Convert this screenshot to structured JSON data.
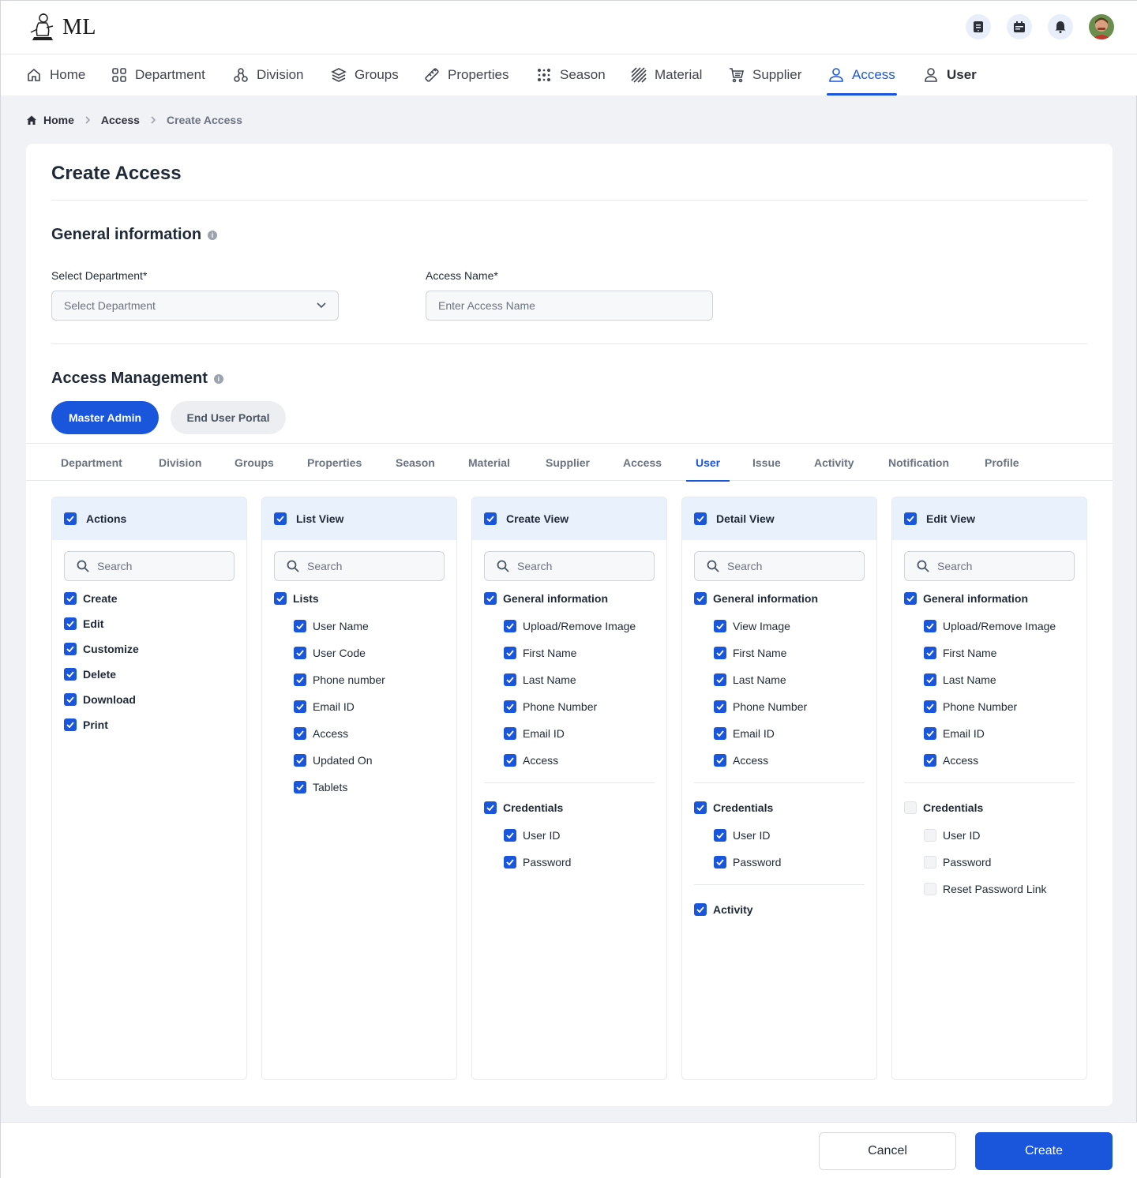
{
  "brand": {
    "logo_text": "ML"
  },
  "nav": [
    {
      "label": "Home",
      "icon": "home-icon"
    },
    {
      "label": "Department",
      "icon": "grid-icon"
    },
    {
      "label": "Division",
      "icon": "hierarchy-icon"
    },
    {
      "label": "Groups",
      "icon": "layers-icon"
    },
    {
      "label": "Properties",
      "icon": "ruler-icon"
    },
    {
      "label": "Season",
      "icon": "dots-grid-icon"
    },
    {
      "label": "Material",
      "icon": "stripes-icon"
    },
    {
      "label": "Supplier",
      "icon": "cart-icon"
    },
    {
      "label": "Access",
      "icon": "user-lock-icon"
    },
    {
      "label": "User",
      "icon": "user-icon"
    }
  ],
  "nav_active": "Access",
  "breadcrumb": {
    "home": "Home",
    "parent": "Access",
    "current": "Create Access"
  },
  "page": {
    "title": "Create Access"
  },
  "general": {
    "heading": "General information",
    "department_label": "Select Department*",
    "department_placeholder": "Select Department",
    "access_name_label": "Access Name*",
    "access_name_placeholder": "Enter Access Name"
  },
  "access_mgmt": {
    "heading": "Access Management",
    "portal_tabs": [
      "Master Admin",
      "End User Portal"
    ],
    "portal_active": "Master Admin",
    "module_tabs": [
      "Department",
      "Division",
      "Groups",
      "Properties",
      "Season",
      "Material",
      "Supplier",
      "Access",
      "User",
      "Issue",
      "Activity",
      "Notification",
      "Profile"
    ],
    "module_active": "User"
  },
  "search_placeholder": "Search",
  "panels": [
    {
      "title": "Actions",
      "checked": true,
      "groups": [
        {
          "items": [
            {
              "label": "Create",
              "checked": true
            },
            {
              "label": "Edit",
              "checked": true
            },
            {
              "label": "Customize",
              "checked": true
            },
            {
              "label": "Delete",
              "checked": true
            },
            {
              "label": "Download",
              "checked": true
            },
            {
              "label": "Print",
              "checked": true
            }
          ]
        }
      ]
    },
    {
      "title": "List View",
      "checked": true,
      "groups": [
        {
          "label": "Lists",
          "checked": true,
          "items": [
            {
              "label": "User Name",
              "checked": true
            },
            {
              "label": "User Code",
              "checked": true
            },
            {
              "label": "Phone number",
              "checked": true
            },
            {
              "label": "Email ID",
              "checked": true
            },
            {
              "label": "Access",
              "checked": true
            },
            {
              "label": "Updated On",
              "checked": true
            },
            {
              "label": "Tablets",
              "checked": true
            }
          ]
        }
      ]
    },
    {
      "title": "Create View",
      "checked": true,
      "groups": [
        {
          "label": "General information",
          "checked": true,
          "items": [
            {
              "label": "Upload/Remove Image",
              "checked": true
            },
            {
              "label": "First Name",
              "checked": true
            },
            {
              "label": "Last Name",
              "checked": true
            },
            {
              "label": "Phone Number",
              "checked": true
            },
            {
              "label": "Email ID",
              "checked": true
            },
            {
              "label": "Access",
              "checked": true
            }
          ]
        },
        {
          "label": "Credentials",
          "checked": true,
          "items": [
            {
              "label": "User ID",
              "checked": true
            },
            {
              "label": "Password",
              "checked": true
            }
          ]
        }
      ]
    },
    {
      "title": "Detail View",
      "checked": true,
      "groups": [
        {
          "label": "General information",
          "checked": true,
          "items": [
            {
              "label": "View Image",
              "checked": true
            },
            {
              "label": "First Name",
              "checked": true
            },
            {
              "label": "Last Name",
              "checked": true
            },
            {
              "label": "Phone Number",
              "checked": true
            },
            {
              "label": "Email ID",
              "checked": true
            },
            {
              "label": "Access",
              "checked": true
            }
          ]
        },
        {
          "label": "Credentials",
          "checked": true,
          "items": [
            {
              "label": "User ID",
              "checked": true
            },
            {
              "label": "Password",
              "checked": true
            }
          ]
        },
        {
          "label": "Activity",
          "checked": true,
          "items": []
        }
      ]
    },
    {
      "title": "Edit View",
      "checked": true,
      "groups": [
        {
          "label": "General information",
          "checked": true,
          "items": [
            {
              "label": "Upload/Remove Image",
              "checked": true
            },
            {
              "label": "First Name",
              "checked": true
            },
            {
              "label": "Last Name",
              "checked": true
            },
            {
              "label": "Phone Number",
              "checked": true
            },
            {
              "label": "Email ID",
              "checked": true
            },
            {
              "label": "Access",
              "checked": true
            }
          ]
        },
        {
          "label": "Credentials",
          "checked": false,
          "items": [
            {
              "label": "User ID",
              "checked": false
            },
            {
              "label": "Password",
              "checked": false
            },
            {
              "label": "Reset Password Link",
              "checked": false
            }
          ]
        }
      ]
    }
  ],
  "footer": {
    "cancel": "Cancel",
    "create": "Create"
  },
  "colors": {
    "primary": "#1a56db",
    "panel_header": "#e8f1fc",
    "background": "#f1f2f6"
  }
}
